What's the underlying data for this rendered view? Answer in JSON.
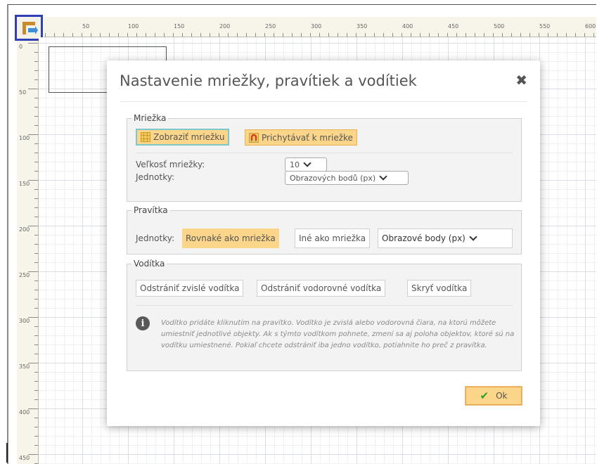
{
  "ruler": {
    "h_labels": [
      "50",
      "100",
      "150",
      "200",
      "250",
      "300",
      "350",
      "400",
      "450",
      "500",
      "550",
      "600"
    ],
    "v_labels": [
      "0",
      "50",
      "100",
      "150",
      "200",
      "250",
      "300",
      "350",
      "400",
      "450"
    ]
  },
  "dialog": {
    "title": "Nastavenie mriežky, pravítiek a vodítiek",
    "close_icon": "✖",
    "grid": {
      "legend": "Mriežka",
      "show_grid": "Zobraziť mriežku",
      "snap_to_grid": "Prichytávať k mriežke",
      "size_label": "Veľkosť mriežky:",
      "size_value": "10",
      "units_label": "Jednotky:",
      "units_value": "Obrazových bodů (px)"
    },
    "rulers": {
      "legend": "Pravítka",
      "units_label": "Jednotky:",
      "same_as_grid": "Rovnaké ako mriežka",
      "different": "Iné ako mriežka",
      "units_value": "Obrazové body (px)"
    },
    "guides": {
      "legend": "Vodítka",
      "remove_vertical": "Odstrániť zvislé vodítka",
      "remove_horizontal": "Odstrániť vodorovné vodítka",
      "hide": "Skryť vodítka",
      "info_icon": "i",
      "info": "Vodítko pridáte kliknutím na pravítko. Vodítko je zvislá alebo vodorovná čiara, na ktorú môžete umiestniť jednotlivé objekty. Ak s týmto vodítkom pohnete, zmení sa aj poloha objektov, ktoré sú na vodítku umiestnené. Pokiaľ chcete odstrániť iba jedno vodítko, potiahnite ho preč z pravítka."
    },
    "ok_label": "Ok",
    "ok_icon": "✔"
  },
  "colors": {
    "accent_orange": "#fbd68a",
    "focus_outline": "#7fc6c8",
    "corner_highlight": "#2f3fb6",
    "ok_check": "#2e9e2e"
  },
  "icons": [
    "ruler-toggle-icon",
    "grid-icon",
    "magnet-icon",
    "close-icon",
    "info-icon",
    "checkmark-icon",
    "chevron-down-icon"
  ]
}
